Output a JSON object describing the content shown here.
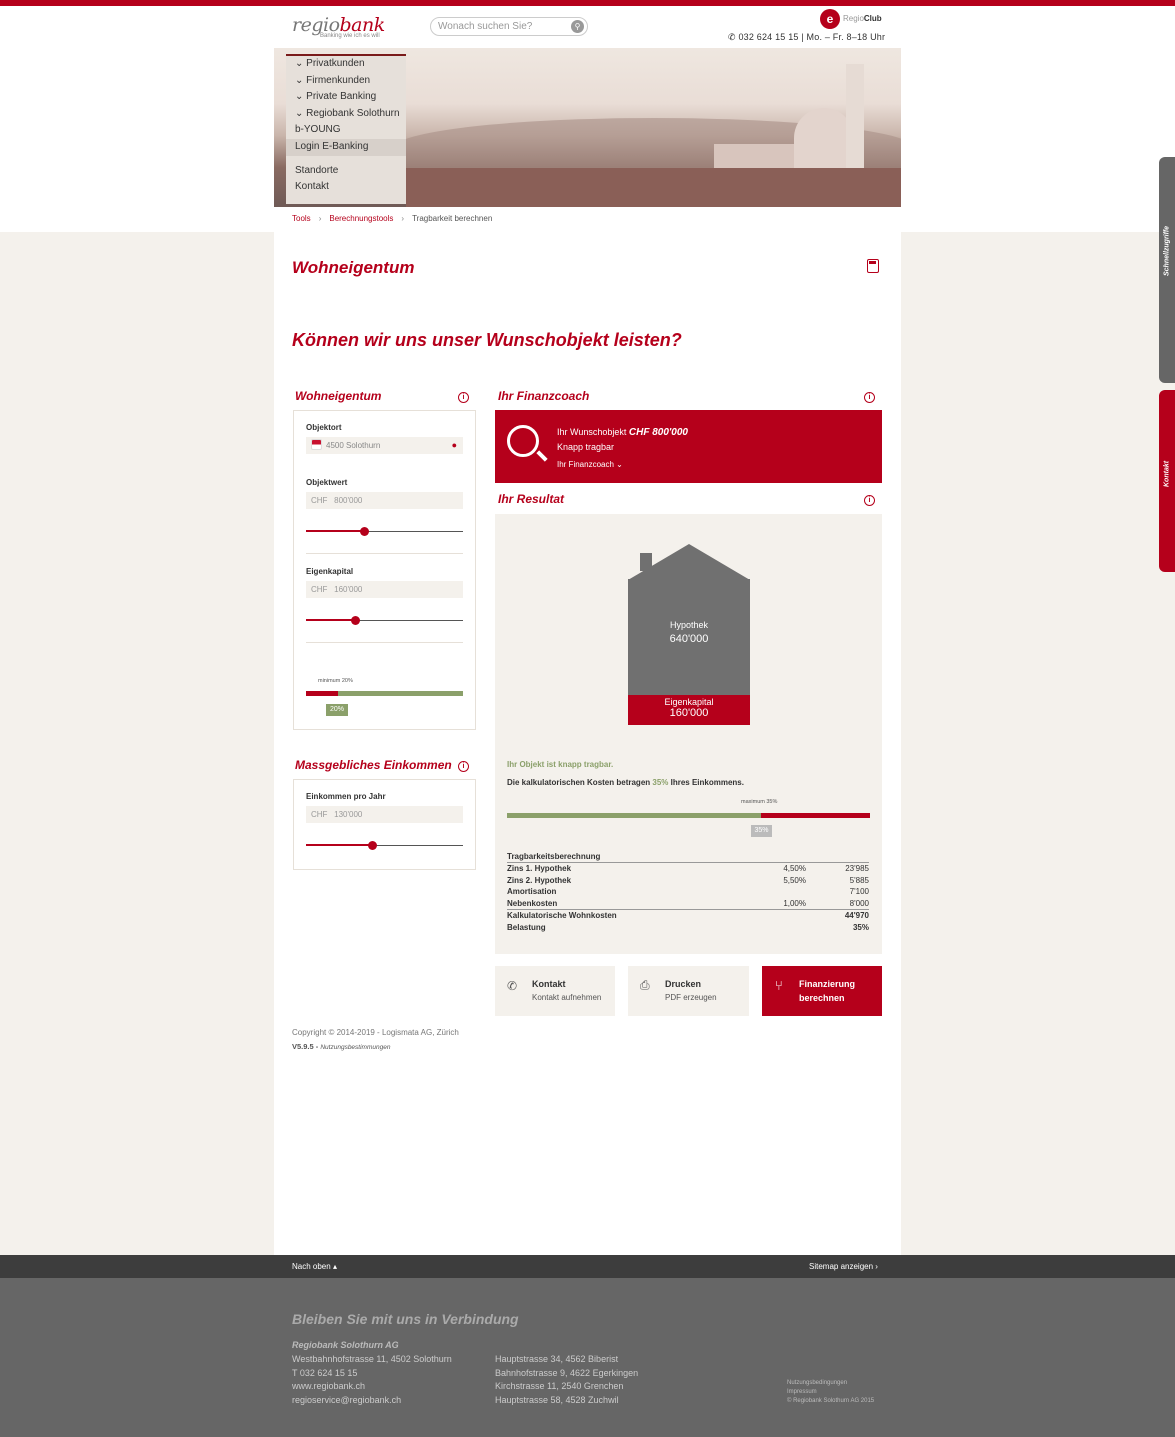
{
  "brand": {
    "logo_main": "regio",
    "logo_accent": "bank",
    "tagline": "Banking wie ich es will",
    "club_logo": "e",
    "club_prefix": "Regio",
    "club_name": "Club"
  },
  "search": {
    "placeholder": "Wonach suchen Sie?"
  },
  "contact": {
    "phone": "032 624 15 15 | Mo. – Fr. 8–18 Uhr"
  },
  "nav": {
    "items": [
      "Privatkunden",
      "Firmenkunden",
      "Private Banking",
      "Regiobank Solothurn",
      "b-YOUNG",
      "Login E-Banking",
      "Standorte",
      "Kontakt"
    ]
  },
  "breadcrumb": {
    "items": [
      "Tools",
      "Berechnungstools",
      "Tragbarkeit berechnen"
    ]
  },
  "page": {
    "title": "Wohneigentum",
    "question": "Können wir uns unser Wunschobjekt leisten?"
  },
  "left": {
    "section_title": "Wohneigentum",
    "objektort_label": "Objektort",
    "objektort_value": "4500 Solothurn",
    "objektwert_label": "Objektwert",
    "objektwert_currency": "CHF",
    "objektwert_value": "800'000",
    "objektwert_slider": 0.37,
    "eigenkapital_label": "Eigenkapital",
    "eigenkapital_currency": "CHF",
    "eigenkapital_value": "160'000",
    "eigenkapital_slider": 0.31,
    "min_label": "minimum 20%",
    "min_badge": "20%",
    "min_marker": 0.2,
    "income_title": "Massgebliches Einkommen",
    "income_label": "Einkommen pro Jahr",
    "income_currency": "CHF",
    "income_value": "130'000",
    "income_slider": 0.42
  },
  "coach": {
    "section_title": "Ihr Finanzcoach",
    "object_prefix": "Ihr Wunschobjekt ",
    "object_amount": "CHF 800'000",
    "status": "Knapp tragbar",
    "link": "Ihr Finanzcoach"
  },
  "result": {
    "section_title": "Ihr Resultat",
    "mortgage_label": "Hypothek",
    "mortgage_value": "640'000",
    "equity_label": "Eigenkapital",
    "equity_value": "160'000",
    "verdict": "Ihr Objekt ist knapp tragbar.",
    "cost_text_pre": "Die kalkulatorischen Kosten betragen ",
    "cost_pct": "35%",
    "cost_text_post": " Ihres Einkommens.",
    "max_label": "maximum 35%",
    "badge": "35%",
    "load_fraction": 0.7,
    "table_title": "Tragbarkeitsberechnung",
    "rows": [
      {
        "label": "Zins 1. Hypothek",
        "rate": "4,50%",
        "value": "23'985"
      },
      {
        "label": "Zins 2. Hypothek",
        "rate": "5,50%",
        "value": "5'885"
      },
      {
        "label": "Amortisation",
        "rate": "",
        "value": "7'100"
      },
      {
        "label": "Nebenkosten",
        "rate": "1,00%",
        "value": "8'000"
      }
    ],
    "total_label": "Kalkulatorische Wohnkosten",
    "total_value": "44'970",
    "load_label": "Belastung",
    "load_value": "35%"
  },
  "actions": [
    {
      "title": "Kontakt",
      "sub": "Kontakt aufnehmen"
    },
    {
      "title": "Drucken",
      "sub": "PDF erzeugen"
    },
    {
      "title": "Finanzierung",
      "sub": "berechnen"
    }
  ],
  "copyright": {
    "line1": "Copyright © 2014-2019 - Logismata AG, Zürich",
    "version": "V5.9.5 - ",
    "terms": "Nutzungsbestimmungen"
  },
  "side": {
    "tab1": "Schnellzugriffe",
    "tab2": "Kontakt"
  },
  "footer": {
    "back_top": "Nach oben",
    "sitemap": "Sitemap anzeigen",
    "heading": "Bleiben Sie mit uns in Verbindung",
    "company": "Regiobank Solothurn AG",
    "col1": [
      "Westbahnhofstrasse 11, 4502 Solothurn",
      "T 032 624 15 15",
      "www.regiobank.ch",
      "regioservice@regiobank.ch"
    ],
    "col2": [
      "Hauptstrasse 34, 4562 Biberist",
      "Bahnhofstrasse 9, 4622 Egerkingen",
      "Kirchstrasse 11, 2540 Grenchen",
      "Hauptstrasse 58, 4528 Zuchwil"
    ],
    "legal": [
      "Nutzungsbedingungen",
      "Impressum",
      "© Regiobank Solothurn AG 2015"
    ]
  },
  "colors": {
    "brand_red": "#b5001b",
    "green": "#8ba06a",
    "grey_house": "#707070"
  }
}
